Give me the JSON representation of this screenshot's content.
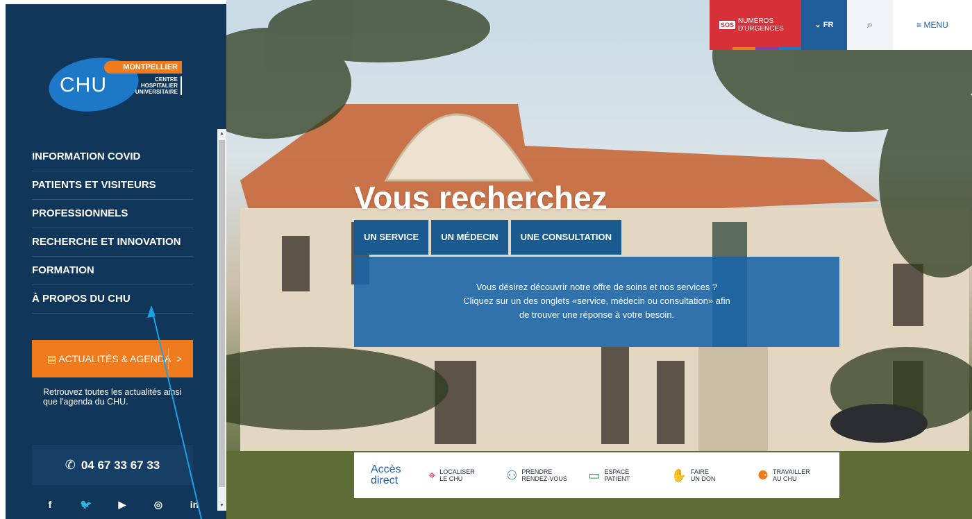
{
  "logo": {
    "brand": "CHU",
    "city": "MONTPELLIER",
    "subtitle": [
      "CENTRE",
      "HOSPITALIER",
      "UNIVERSITAIRE"
    ]
  },
  "nav": {
    "items": [
      {
        "label": "INFORMATION COVID"
      },
      {
        "label": "PATIENTS ET VISITEURS"
      },
      {
        "label": "PROFESSIONNELS"
      },
      {
        "label": "RECHERCHE ET INNOVATION"
      },
      {
        "label": "FORMATION"
      },
      {
        "label": "À PROPOS DU CHU"
      }
    ]
  },
  "news": {
    "icon": "newspaper-icon",
    "label": "ACTUALITÉS & AGENDA",
    "arrow": ">",
    "description": "Retrouvez toutes les actualités ainsi que l'agenda du CHU."
  },
  "phone": {
    "icon": "phone-icon",
    "number": "04 67 33 67 33"
  },
  "socials": [
    {
      "icon": "facebook-icon",
      "glyph": "f"
    },
    {
      "icon": "twitter-icon",
      "glyph": "🐦"
    },
    {
      "icon": "youtube-icon",
      "glyph": "▶"
    },
    {
      "icon": "instagram-icon",
      "glyph": "◎"
    },
    {
      "icon": "linkedin-icon",
      "glyph": "in"
    }
  ],
  "topbar": {
    "sos_badge": "SOS",
    "sos_line1": "NUMÉROS",
    "sos_line2": "D'URGENCES",
    "lang": "FR",
    "menu": "MENU"
  },
  "hero": {
    "title": "Vous recherchez",
    "tabs": [
      "UN SERVICE",
      "UN MÉDECIN",
      "UNE CONSULTATION"
    ],
    "panel_lines": [
      "Vous désirez découvrir notre offre de soins et nos services ?",
      "Cliquez sur un des onglets «service, médecin ou consultation» afin",
      "de trouver une réponse à votre besoin."
    ]
  },
  "quick_access": {
    "title_line1": "Accès",
    "title_line2": "direct",
    "items": [
      {
        "icon": "map-pin-icon",
        "line1": "LOCALISER",
        "line2": "LE CHU",
        "color": "#d6336c"
      },
      {
        "icon": "people-icon",
        "line1": "PRENDRE",
        "line2": "RENDEZ-VOUS",
        "color": "#1e78c8"
      },
      {
        "icon": "card-icon",
        "line1": "ESPACE",
        "line2": "PATIENT",
        "color": "#22a34b"
      },
      {
        "icon": "hand-heart-icon",
        "line1": "FAIRE",
        "line2": "UN DON",
        "color": "#d63038"
      },
      {
        "icon": "group-icon",
        "line1": "TRAVAILLER",
        "line2": "AU CHU",
        "color": "#f07b1e"
      }
    ]
  },
  "colors": {
    "sidebar": "#10365a",
    "accent_orange": "#f07b1e",
    "accent_blue": "#1e5fa8",
    "sos_red": "#d63038"
  }
}
